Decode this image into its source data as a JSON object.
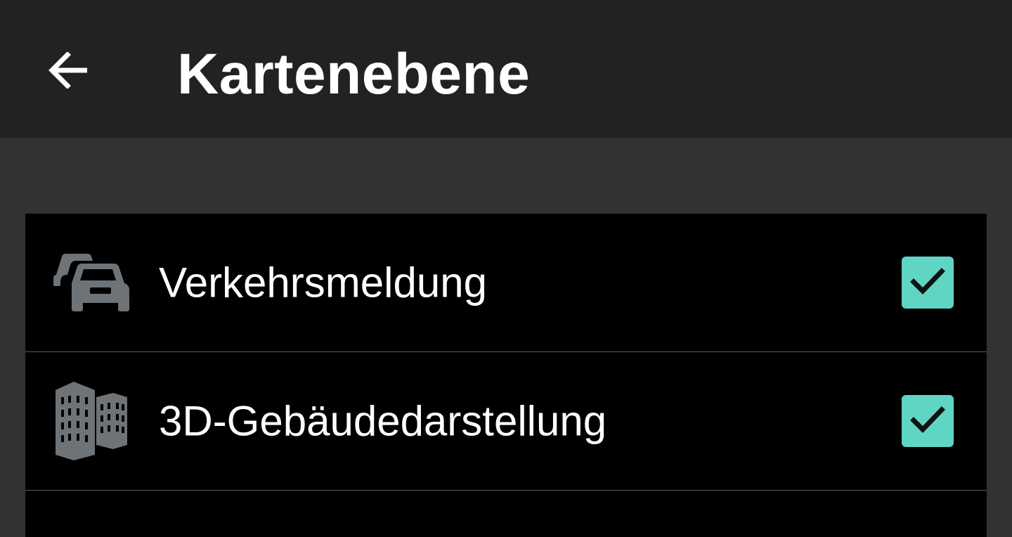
{
  "header": {
    "title": "Kartenebene",
    "back_icon": "arrow-left-icon"
  },
  "layers": [
    {
      "label": "Verkehrsmeldung",
      "icon": "traffic-cars-icon",
      "checked": true
    },
    {
      "label": "3D-Gebäudedarstellung",
      "icon": "buildings-icon",
      "checked": true
    }
  ],
  "colors": {
    "app_bar": "#222222",
    "background": "#323232",
    "list_background": "#000000",
    "checkbox_accent": "#5fd6c4",
    "icon_gray": "#6e7378"
  }
}
